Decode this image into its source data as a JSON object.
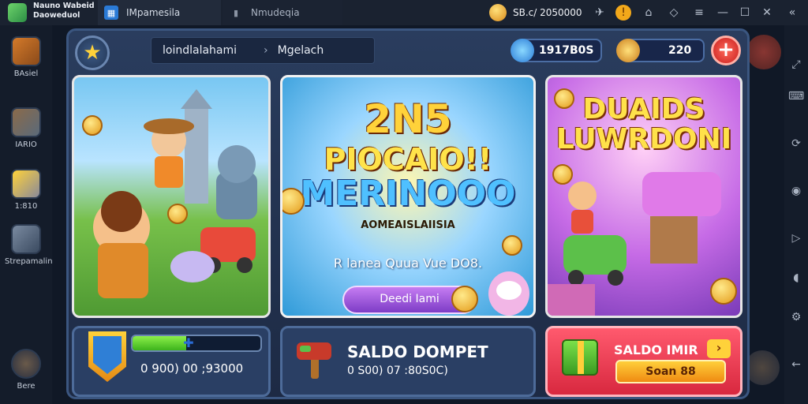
{
  "titlebar": {
    "app_name": "Nauno Wabeid Daoweduol",
    "tab1_label": "IMpamesila",
    "tab2_label": "Nmudeqia",
    "balance_text": "SB.c/ 2050000"
  },
  "left_rail": {
    "items": [
      {
        "label": "BAsiel"
      },
      {
        "label": "IARIO"
      },
      {
        "label": "1:810"
      },
      {
        "label": "Strepamalin"
      },
      {
        "label": "Bere"
      }
    ]
  },
  "topbar": {
    "breadcrumb_1": "loindlalahami",
    "breadcrumb_2": "Mgelach",
    "currency_1": "1917B0S",
    "currency_2": "220"
  },
  "cards": {
    "promo2": {
      "line1": "2N5",
      "line2": "PIOCAIO!!",
      "line3": "MERINOOO",
      "subtitle": "AOMEAISLAIISIA",
      "description": "R lanea Quua Vue DO8.",
      "cta_label": "Deedi Iami"
    },
    "promo3": {
      "line1": "DUAIDS",
      "line2": "LUWRDONI"
    }
  },
  "bottom": {
    "wallet_amount": "0 900) 00 ;93000",
    "wallet_progress": 0.42,
    "panel2_title": "SALDO DOMPET",
    "panel2_amount": "0 S00) 07 :80S0C)",
    "panel3_title": "SALDO IMIR",
    "panel3_button": "Soan 88"
  },
  "colors": {
    "accent": "#3b5680",
    "gold": "#ffd23a",
    "danger": "#d8283f"
  }
}
